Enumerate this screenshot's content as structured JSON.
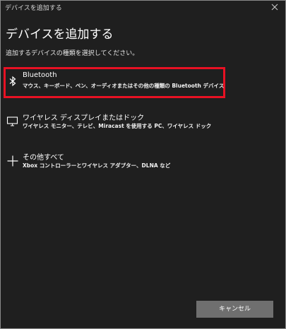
{
  "window": {
    "title": "デバイスを追加する"
  },
  "header": {
    "title": "デバイスを追加する",
    "subtitle": "追加するデバイスの種類を選択してください。"
  },
  "options": [
    {
      "icon": "bluetooth-icon",
      "label": "Bluetooth",
      "description": "マウス、キーボード、ペン、オーディオまたはその他の種類の Bluetooth デバイス",
      "selected": true
    },
    {
      "icon": "monitor-icon",
      "label": "ワイヤレス ディスプレイまたはドック",
      "description": "ワイヤレス モニター、テレビ、Miracast を使用する PC、ワイヤレス ドック",
      "selected": false
    },
    {
      "icon": "plus-icon",
      "label": "その他すべて",
      "description": "Xbox コントローラーとワイヤレス アダプター、DLNA など",
      "selected": false
    }
  ],
  "footer": {
    "cancel_label": "キャンセル"
  },
  "colors": {
    "background": "#1f1f1f",
    "highlight_border": "#e81123",
    "button": "#6f6f6f"
  }
}
